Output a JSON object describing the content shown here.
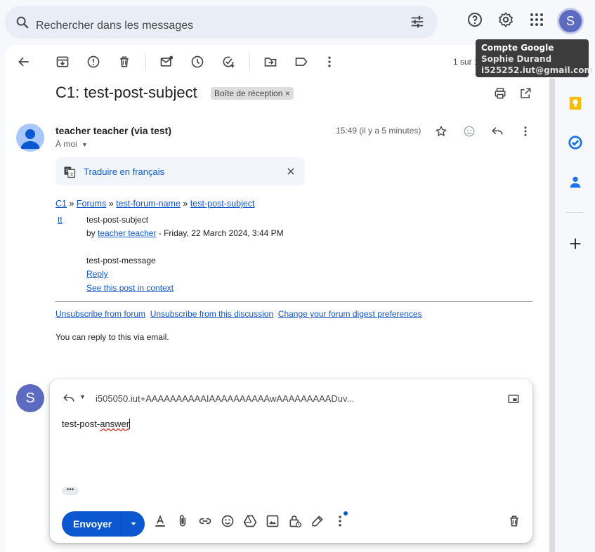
{
  "search": {
    "placeholder": "Rechercher dans les messages"
  },
  "account": {
    "avatar_letter": "S"
  },
  "tooltip": {
    "title": "Compte Google",
    "name": "Sophie Durand",
    "email": "i525252.iut@gmail.com"
  },
  "toolbar": {
    "pager": "1 sur 1"
  },
  "message": {
    "subject": "C1: test-post-subject",
    "label": "Boîte de réception",
    "label_close": "×",
    "sender": "teacher teacher",
    "sender_via": "(via test)",
    "to": "À moi",
    "time": "15:49 (il y a 5 minutes)",
    "translate": "Traduire en français",
    "breadcrumb": {
      "c1": "C1",
      "sep": "»",
      "forums": "Forums",
      "forum_name": "test-forum-name",
      "post_subject": "test-post-subject"
    },
    "initials": "tt",
    "post_title": "test-post-subject",
    "by": "by",
    "author": "teacher teacher",
    "date": "- Friday, 22 March 2024, 3:44 PM",
    "post_message": "test-post-message",
    "reply_link": "Reply",
    "context_link": "See this post in context",
    "unsubscribe_forum": "Unsubscribe from forum",
    "unsubscribe_discussion": "Unsubscribe from this discussion",
    "digest": "Change your forum digest preferences",
    "reply_via_email": "You can reply to this via email."
  },
  "reply": {
    "avatar_letter": "S",
    "recipient": "i505050.iut+AAAAAAAAAAIAAAAAAAAAAwAAAAAAAAADuv...",
    "text_prefix": "test-post-",
    "text_misspelled": "answer",
    "send": "Envoyer",
    "ellipsis": "•••"
  }
}
